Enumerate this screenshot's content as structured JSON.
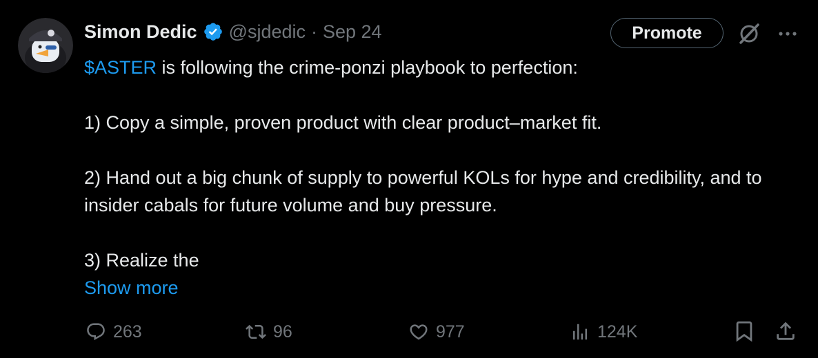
{
  "author": {
    "name": "Simon Dedic",
    "handle": "@sjdedic",
    "separator": "·",
    "date": "Sep 24",
    "verified": true
  },
  "header_actions": {
    "promote_label": "Promote",
    "grok_icon": "grok-icon",
    "more_icon": "more-dots-icon"
  },
  "post": {
    "cashtag": "$ASTER",
    "line1_rest": " is following the crime-ponzi playbook to perfection:",
    "point1": "1) Copy a simple, proven product with clear product–market fit.",
    "point2": "2) Hand out a big chunk of supply to powerful KOLs for hype and credibility, and to insider cabals for future volume and buy pressure.",
    "point3": "3) Realize the",
    "show_more": "Show more"
  },
  "stats": {
    "replies": "263",
    "reposts": "96",
    "likes": "977",
    "views": "124K"
  },
  "colors": {
    "background": "#000000",
    "text": "#e7e9ea",
    "muted": "#71767b",
    "accent": "#1d9bf0",
    "border": "#536471"
  }
}
